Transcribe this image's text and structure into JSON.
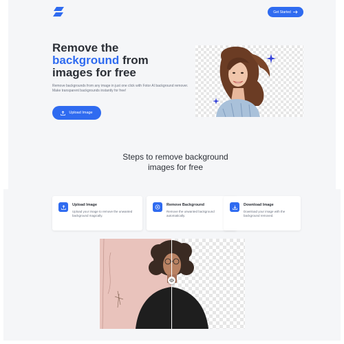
{
  "header": {
    "cta_label": "Get Started",
    "cta_icon": "arrow-right-icon"
  },
  "hero": {
    "title_line1": "Remove the",
    "title_accent": "background",
    "title_line2": " from",
    "title_line3": "images for free",
    "desc_line1": "Remove backgrounds from any image in just one click with Fotor AI background remover.",
    "desc_line2": "Make transparent backgrounds instantly for free!",
    "upload_label": "Upload Image",
    "upload_icon": "upload-icon"
  },
  "steps": {
    "title_line1": "Steps to remove background",
    "title_line2": "images for free",
    "items": [
      {
        "title": "Upload Image",
        "desc": "Upload your image to remove the unwanted background magically.",
        "icon": "upload-icon"
      },
      {
        "title": "Remove Background",
        "desc": "Remove the unwanted background automatically.",
        "icon": "magic-icon"
      },
      {
        "title": "Download Image",
        "desc": "Download your image with the background removed.",
        "icon": "download-icon"
      }
    ]
  },
  "colors": {
    "accent": "#2f6bf0",
    "heading": "#2b2f36",
    "muted": "#6b7280",
    "band": "#f5f6f8"
  }
}
